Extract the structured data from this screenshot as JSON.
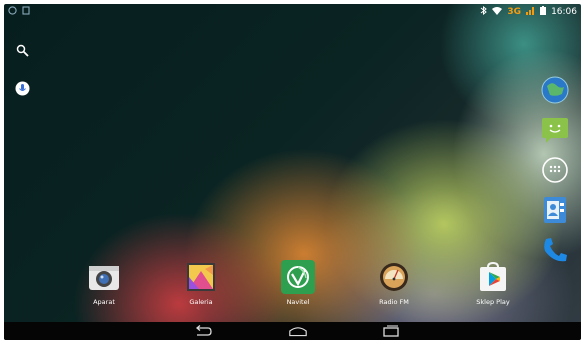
{
  "statusbar": {
    "network": "3G",
    "time": "16:06"
  },
  "left_icons": [
    "search-icon",
    "mic-icon"
  ],
  "dock_right": [
    "browser-icon",
    "messaging-icon",
    "all-apps-icon",
    "contacts-icon",
    "phone-icon"
  ],
  "apps": [
    {
      "label": "Aparat",
      "icon": "camera-icon"
    },
    {
      "label": "Galeria",
      "icon": "gallery-icon"
    },
    {
      "label": "Navitel",
      "icon": "navitel-icon"
    },
    {
      "label": "Radio FM",
      "icon": "radio-icon"
    },
    {
      "label": "Sklep Play",
      "icon": "play-store-icon"
    }
  ],
  "navbar": [
    "back-icon",
    "home-icon",
    "recents-icon"
  ],
  "colors": {
    "accent_3g": "#f39c12",
    "messaging": "#8bc34a",
    "phone": "#1e88e5"
  }
}
